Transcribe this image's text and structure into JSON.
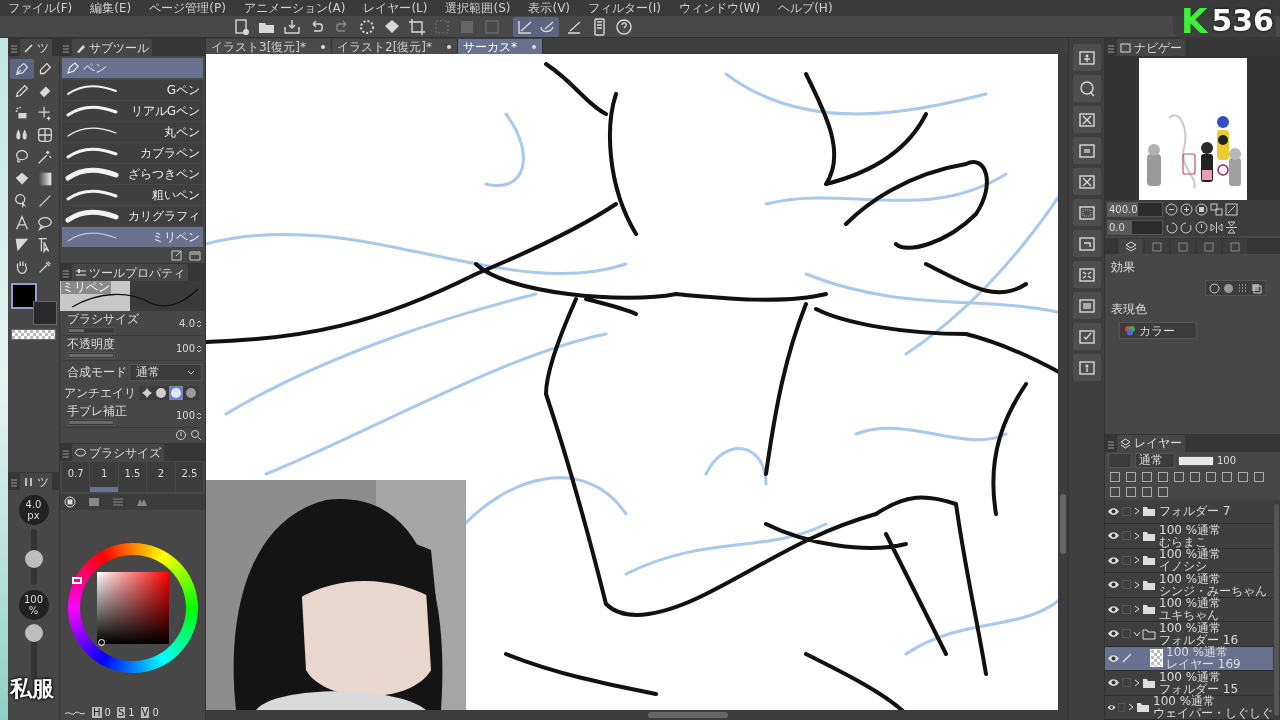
{
  "menu_bar": [
    "ファイル(F)",
    "編集(E)",
    "ページ管理(P)",
    "アニメーション(A)",
    "レイヤー(L)",
    "選択範囲(S)",
    "表示(V)",
    "フィルター(I)",
    "ウィンドウ(W)",
    "ヘルプ(H)"
  ],
  "canvas_tabs": [
    {
      "label": "イラスト3[復元]*",
      "selected": false
    },
    {
      "label": "イラスト2[復元]*",
      "selected": false
    },
    {
      "label": "サーカス*",
      "selected": true
    }
  ],
  "tool_palette": {
    "tab": "ツ",
    "tools": [
      {
        "kind": "pen",
        "selected": true
      },
      {
        "kind": "marker",
        "selected": false
      },
      {
        "kind": "pencil",
        "selected": false
      },
      {
        "kind": "eraser",
        "selected": false
      },
      {
        "kind": "airbrush",
        "selected": false
      },
      {
        "kind": "sparkle",
        "selected": false
      },
      {
        "kind": "blend",
        "selected": false
      },
      {
        "kind": "mesh",
        "selected": false
      },
      {
        "kind": "lasso",
        "selected": false
      },
      {
        "kind": "wand",
        "selected": false
      },
      {
        "kind": "fill",
        "selected": false
      },
      {
        "kind": "gradient",
        "selected": false
      },
      {
        "kind": "figure",
        "selected": false
      },
      {
        "kind": "line",
        "selected": false
      },
      {
        "kind": "text",
        "selected": false
      },
      {
        "kind": "balloon",
        "selected": false
      },
      {
        "kind": "ruler",
        "selected": false
      },
      {
        "kind": "object",
        "selected": false
      },
      {
        "kind": "hand",
        "selected": false
      },
      {
        "kind": "eyedropper",
        "selected": false
      }
    ]
  },
  "subtool": {
    "tab": "サブツール",
    "group": "ペン",
    "items": [
      {
        "label": "Gペン",
        "selected": false
      },
      {
        "label": "リアルGペン",
        "selected": false
      },
      {
        "label": "丸ペン",
        "selected": false
      },
      {
        "label": "カブラペン",
        "selected": false
      },
      {
        "label": "ざらつきペン",
        "selected": false
      },
      {
        "label": "粗いペン",
        "selected": false
      },
      {
        "label": "カリグラフィ",
        "selected": false
      },
      {
        "label": "ミリペン",
        "selected": true
      }
    ]
  },
  "tool_property": {
    "tab": "ツールプロパティ",
    "preview_label": "ミリペン",
    "rows": [
      {
        "kind": "slider",
        "label": "ブラシサイズ",
        "value": "4.0",
        "level": 0.35
      },
      {
        "kind": "slider",
        "label": "不透明度",
        "value": "100",
        "level": 1
      },
      {
        "kind": "select",
        "label": "合成モード",
        "value": "通常"
      },
      {
        "kind": "antialias",
        "label": "アンチエイリ"
      },
      {
        "kind": "slider",
        "label": "手ブレ補正",
        "value": "100",
        "level": 1
      }
    ]
  },
  "side_sliders": {
    "tab": "ツ",
    "size": {
      "reading": "4.0",
      "unit": "px",
      "level": 0.45
    },
    "opacity": {
      "reading": "100",
      "unit": "%",
      "level": 1
    }
  },
  "brush_size_palette": {
    "tab": "ブラシサイズ",
    "sizes": [
      {
        "label": "0.7",
        "selected": false
      },
      {
        "label": "1",
        "selected": true
      },
      {
        "label": "1.5",
        "selected": false
      },
      {
        "label": "2",
        "selected": false
      },
      {
        "label": "2.5",
        "selected": false
      }
    ]
  },
  "color_values": [
    {
      "label": "H",
      "value": "0"
    },
    {
      "label": "S",
      "value": "1"
    },
    {
      "label": "V",
      "value": "0"
    }
  ],
  "overlay": {
    "counter_letter": "K",
    "counter": "536",
    "caption": "私服"
  },
  "navigator": {
    "tab": "ナビゲー",
    "zoom": {
      "value": "400.0",
      "level": 0.55
    },
    "rotation": {
      "value": "0.0",
      "level": 0.45
    }
  },
  "layer_property": {
    "effect_label": "効果",
    "color_label": "表現色",
    "color_mode": "カラー"
  },
  "layers": {
    "tab": "レイヤー",
    "blend_mode": "通常",
    "opacity": {
      "value": "100",
      "level": 1
    },
    "items": [
      {
        "kind": "folder",
        "name": "フォルダー 7",
        "expanded": false,
        "selected": false
      },
      {
        "kind": "folder",
        "mode": "100 %通常",
        "name": "むらまこ",
        "expanded": false,
        "selected": false
      },
      {
        "kind": "folder",
        "mode": "100 %通常",
        "name": "イノシシ",
        "expanded": false,
        "selected": false
      },
      {
        "kind": "folder",
        "mode": "100 %通常",
        "name": "シンジ・みーちゃん",
        "expanded": false,
        "selected": false
      },
      {
        "kind": "folder",
        "mode": "100 %通常",
        "name": "ユキちゃん",
        "expanded": false,
        "selected": false
      },
      {
        "kind": "folder",
        "mode": "100 %通常",
        "name": "フォルダー 16",
        "expanded": true,
        "selected": false,
        "children": [
          {
            "kind": "layer",
            "mode": "100 %通常",
            "name": "レイヤー 169",
            "selected": true
          }
        ]
      },
      {
        "kind": "folder",
        "mode": "100 %通常",
        "name": "フォルダー 15",
        "expanded": false,
        "selected": false
      },
      {
        "kind": "folder",
        "mode": "100 %通常",
        "name": "ウェイパー・しぐしぐ",
        "expanded": false,
        "selected": false
      }
    ]
  }
}
